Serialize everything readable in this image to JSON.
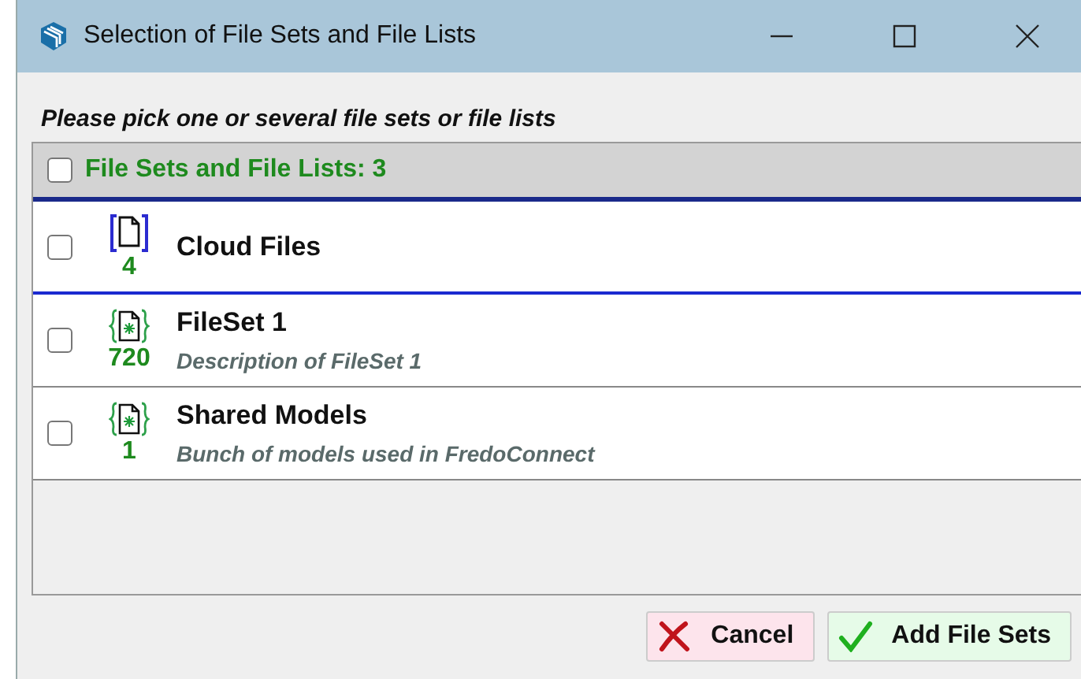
{
  "window": {
    "title": "Selection of File Sets and File Lists"
  },
  "prompt": "Please pick one or several file sets or file lists",
  "list_header": {
    "label": "File Sets and File Lists: 3",
    "checked": false
  },
  "items": [
    {
      "kind": "cloud",
      "name": "Cloud Files",
      "count": "4",
      "checked": false
    },
    {
      "kind": "fileset",
      "name": "FileSet 1",
      "count": "720",
      "description": "Description of FileSet 1",
      "checked": false
    },
    {
      "kind": "fileset",
      "name": "Shared Models",
      "count": "1",
      "description": "Bunch of models used in FredoConnect",
      "checked": false
    }
  ],
  "buttons": [
    {
      "kind": "cancel",
      "label": "Cancel"
    },
    {
      "kind": "ok",
      "label": "Add File Sets"
    }
  ]
}
